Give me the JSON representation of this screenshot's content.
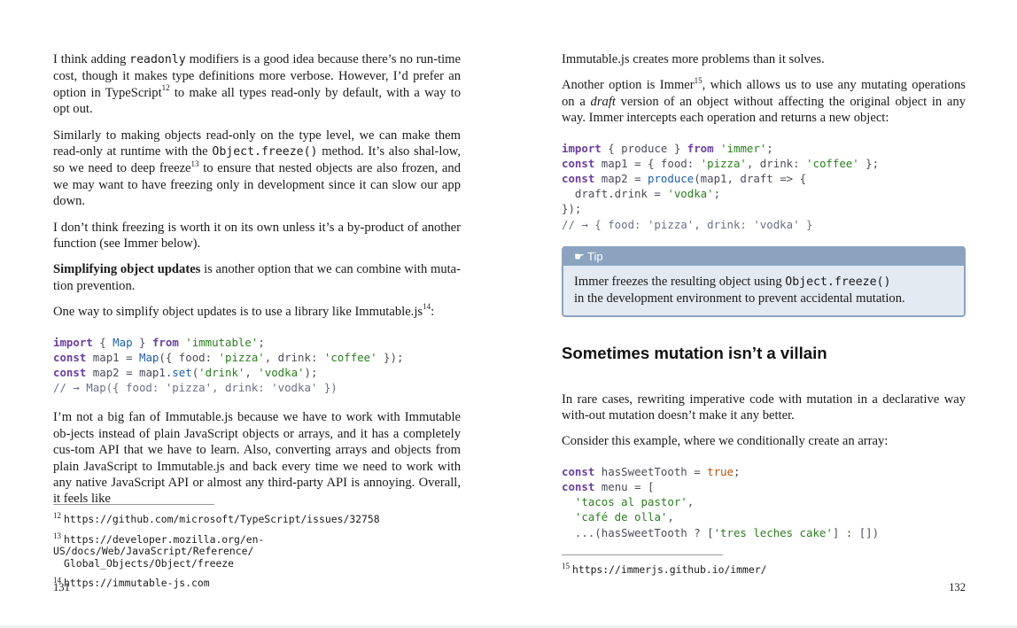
{
  "left_page": {
    "p1": {
      "a": "I think adding ",
      "code": "readonly",
      "b": " modifiers is a good idea because there’s no run-time cost, though it makes type definitions more verbose. However, I’d prefer an option in TypeScript",
      "sup": "12",
      "c": " to make all types read-only by default, with a way to opt out."
    },
    "p2": {
      "a": "Similarly to making objects read-only on the type level, we can make them read-only at runtime with the ",
      "code": "Object.freeze()",
      "b": " method. It’s also shal-low, so we need to deep freeze",
      "sup": "13",
      "c": " to ensure that nested objects are also frozen, and we may want to have freezing only in development since it can slow our app down."
    },
    "p3": "I don’t think freezing is worth it on its own unless it’s a by-product of another function (see Immer below).",
    "p4": {
      "bold": "Simplifying object updates",
      "rest": " is another option that we can combine with muta-tion prevention."
    },
    "p5": {
      "a": "One way to simplify object updates is to use a library like Immutable.js",
      "sup": "14",
      "b": ":"
    },
    "code_block": [
      [
        [
          "kw",
          "import"
        ],
        [
          "plain",
          " { "
        ],
        [
          "fn",
          "Map"
        ],
        [
          "plain",
          " } "
        ],
        [
          "kw",
          "from"
        ],
        [
          "plain",
          " "
        ],
        [
          "str",
          "'immutable'"
        ],
        [
          "plain",
          ";"
        ]
      ],
      [
        [
          "kw",
          "const"
        ],
        [
          "plain",
          " map1 = "
        ],
        [
          "fn",
          "Map"
        ],
        [
          "plain",
          "({ food: "
        ],
        [
          "str",
          "'pizza'"
        ],
        [
          "plain",
          ", drink: "
        ],
        [
          "str",
          "'coffee'"
        ],
        [
          "plain",
          " });"
        ]
      ],
      [
        [
          "kw",
          "const"
        ],
        [
          "plain",
          " map2 = map1."
        ],
        [
          "fn",
          "set"
        ],
        [
          "plain",
          "("
        ],
        [
          "str",
          "'drink'"
        ],
        [
          "plain",
          ", "
        ],
        [
          "str",
          "'vodka'"
        ],
        [
          "plain",
          ");"
        ]
      ],
      [
        [
          "cm",
          "// → Map({ food: 'pizza', drink: 'vodka' })"
        ]
      ]
    ],
    "p6": "I’m not a big fan of Immutable.js because we have to work with Immutable ob-jects instead of plain JavaScript objects or arrays, and it has a completely cus-tom API that we have to learn. Also, converting arrays and objects from plain JavaScript to Immutable.js and back every time we need to work with any native JavaScript API or almost any third-party API is annoying. Overall, it feels like",
    "footnotes": [
      {
        "num": "12",
        "url": "https://github.com/microsoft/TypeScript/issues/32758",
        "cont": ""
      },
      {
        "num": "13",
        "url": "https://developer.mozilla.org/en-US/docs/Web/JavaScript/Reference/",
        "cont": "Global_Objects/Object/freeze"
      },
      {
        "num": "14",
        "url": "https://immutable-js.com",
        "cont": ""
      }
    ],
    "page_number": "131"
  },
  "right_page": {
    "p1": "Immutable.js creates more problems than it solves.",
    "p2": {
      "a": "Another option is Immer",
      "sup": "15",
      "b": ", which allows us to use any mutating operations on a ",
      "em": "draft",
      "c": " version of an object without affecting the original object in any way. Immer intercepts each operation and returns a new object:"
    },
    "code_block_1": [
      [
        [
          "kw",
          "import"
        ],
        [
          "plain",
          " { produce } "
        ],
        [
          "kw",
          "from"
        ],
        [
          "plain",
          " "
        ],
        [
          "str",
          "'immer'"
        ],
        [
          "plain",
          ";"
        ]
      ],
      [
        [
          "kw",
          "const"
        ],
        [
          "plain",
          " map1 = { food: "
        ],
        [
          "str",
          "'pizza'"
        ],
        [
          "plain",
          ", drink: "
        ],
        [
          "str",
          "'coffee'"
        ],
        [
          "plain",
          " };"
        ]
      ],
      [
        [
          "kw",
          "const"
        ],
        [
          "plain",
          " map2 = "
        ],
        [
          "fn",
          "produce"
        ],
        [
          "plain",
          "(map1, draft => {"
        ]
      ],
      [
        [
          "plain",
          "  draft.drink = "
        ],
        [
          "str",
          "'vodka'"
        ],
        [
          "plain",
          ";"
        ]
      ],
      [
        [
          "plain",
          "});"
        ]
      ],
      [
        [
          "cm",
          "// → { food: 'pizza', drink: 'vodka' }"
        ]
      ]
    ],
    "tip": {
      "header": "☛ Tip",
      "a": "Immer freezes the resulting object using ",
      "code": "Object.freeze()",
      "b": "in the development environment to prevent accidental mutation."
    },
    "heading": "Sometimes mutation isn’t a villain",
    "p3": "In rare cases, rewriting imperative code with mutation in a declarative way with-out mutation doesn’t make it any better.",
    "p4": "Consider this example, where we conditionally create an array:",
    "code_block_2": [
      [
        [
          "kw",
          "const"
        ],
        [
          "plain",
          " hasSweetTooth = "
        ],
        [
          "lit",
          "true"
        ],
        [
          "plain",
          ";"
        ]
      ],
      [
        [
          "kw",
          "const"
        ],
        [
          "plain",
          " menu = ["
        ]
      ],
      [
        [
          "plain",
          "  "
        ],
        [
          "str",
          "'tacos al pastor'"
        ],
        [
          "plain",
          ","
        ]
      ],
      [
        [
          "plain",
          "  "
        ],
        [
          "str",
          "'café de olla'"
        ],
        [
          "plain",
          ","
        ]
      ],
      [
        [
          "plain",
          "  ...(hasSweetTooth ? ["
        ],
        [
          "str",
          "'tres leches cake'"
        ],
        [
          "plain",
          "] : [])"
        ]
      ]
    ],
    "footnotes": [
      {
        "num": "15",
        "url": "https://immerjs.github.io/immer/",
        "cont": ""
      }
    ],
    "page_number": "132"
  }
}
